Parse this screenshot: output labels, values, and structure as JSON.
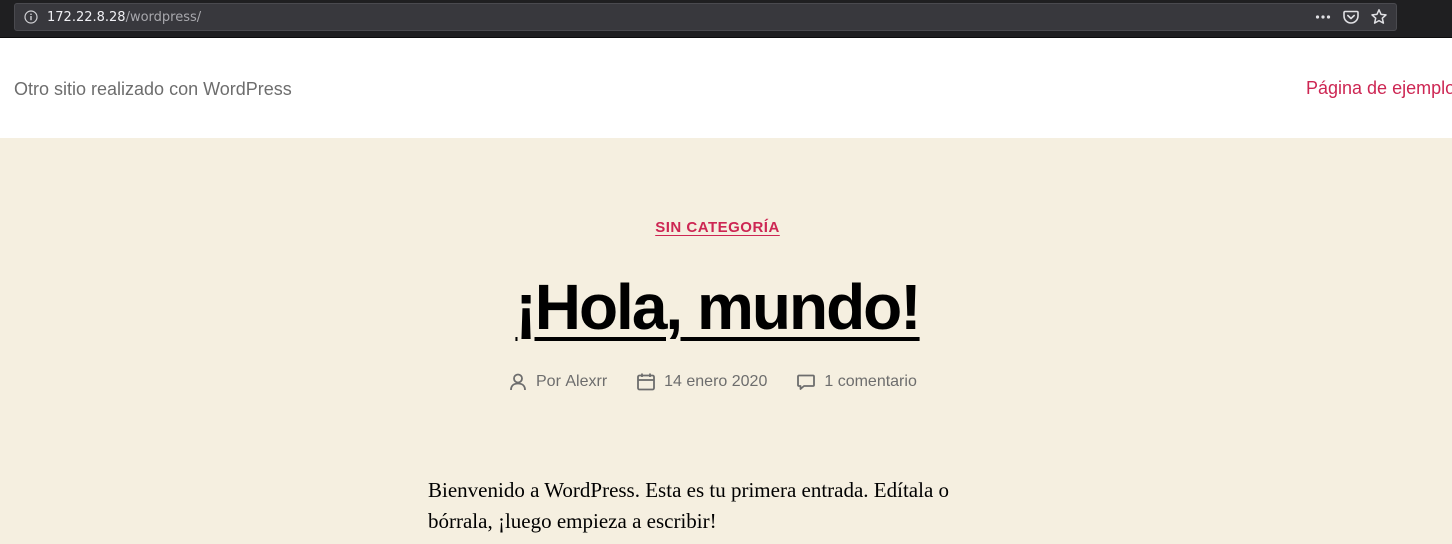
{
  "browser": {
    "url_host": "172.22.8.28",
    "url_path": "/wordpress/",
    "icons": [
      "info-icon",
      "more-icon",
      "pocket-icon",
      "bookmark-star-icon"
    ]
  },
  "header": {
    "site_description": "Otro sitio realizado con WordPress",
    "menu_item": "Página de ejemplo"
  },
  "post": {
    "category": "SIN CATEGORÍA",
    "title": "¡Hola, mundo!",
    "author_prefix": "Por",
    "author": "Alexrr",
    "date": "14 enero 2020",
    "comments": "1 comentario",
    "content": "Bienvenido a WordPress. Esta es tu primera entrada. Edítala o bórrala, ¡luego empieza a escribir!"
  },
  "colors": {
    "accent": "#cd2653",
    "background": "#f5efe0",
    "header_bg": "#ffffff",
    "meta_text": "#6d6d6d"
  }
}
